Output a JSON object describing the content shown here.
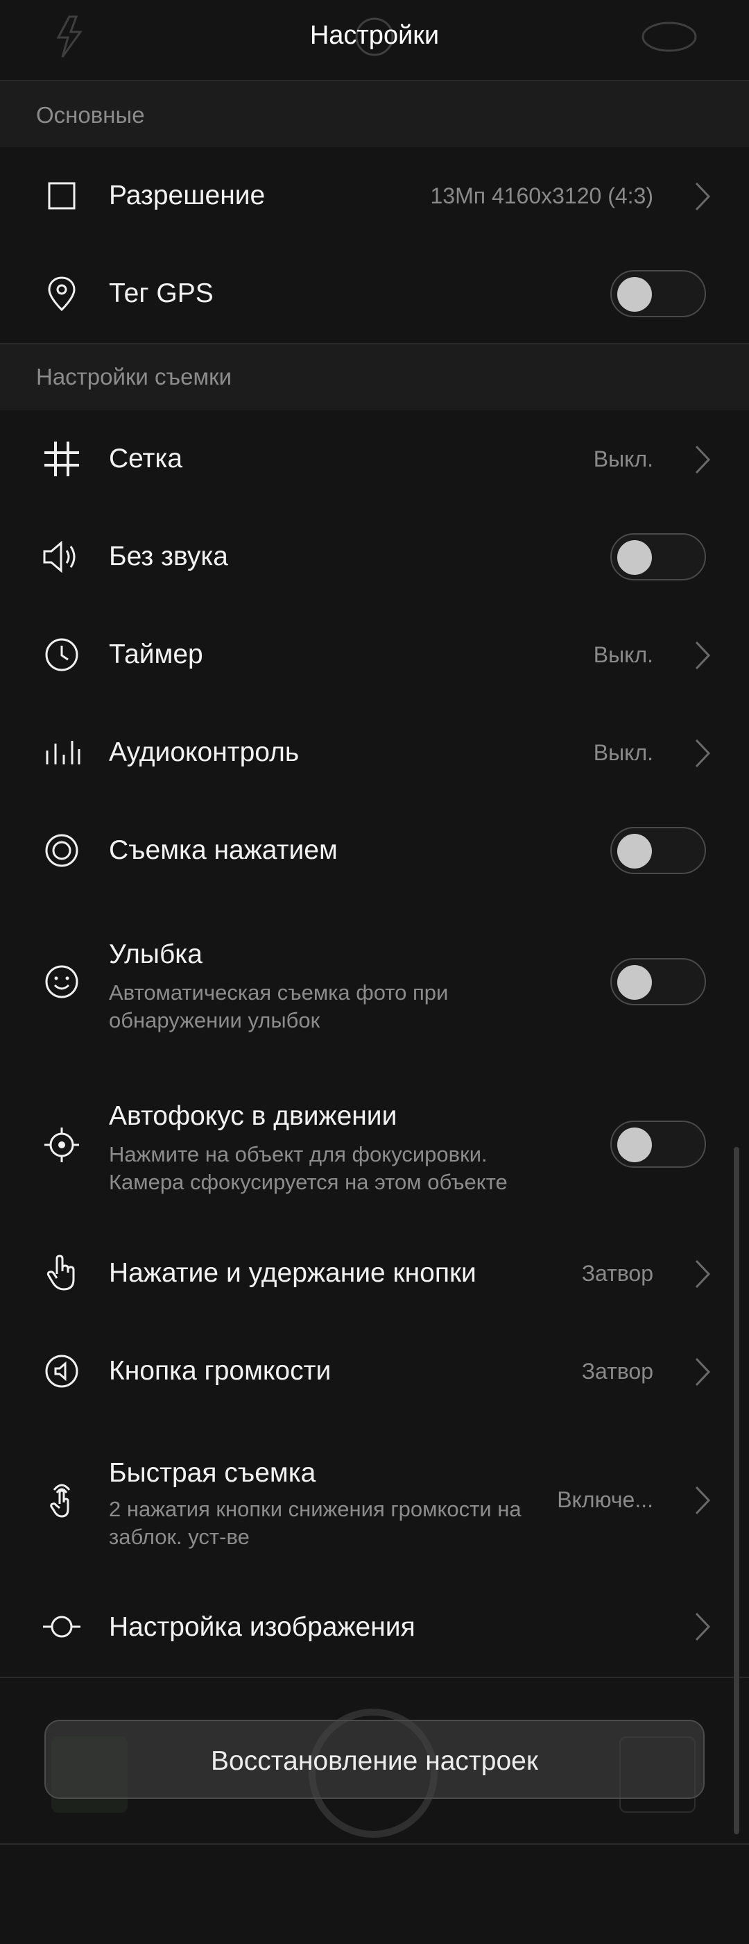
{
  "header": {
    "title": "Настройки"
  },
  "sections": {
    "basic": "Основные",
    "capture": "Настройки съемки"
  },
  "rows": {
    "resolution": {
      "title": "Разрешение",
      "value": "13Мп 4160x3120 (4:3)",
      "icon": "resolution-icon"
    },
    "gps": {
      "title": "Тег GPS",
      "toggle": false,
      "icon": "location-pin-icon"
    },
    "grid": {
      "title": "Сетка",
      "value": "Выкл.",
      "icon": "grid-icon"
    },
    "mute": {
      "title": "Без звука",
      "toggle": false,
      "icon": "speaker-icon"
    },
    "timer": {
      "title": "Таймер",
      "value": "Выкл.",
      "icon": "clock-icon"
    },
    "audio": {
      "title": "Аудиоконтроль",
      "value": "Выкл.",
      "icon": "audio-bars-icon"
    },
    "touch": {
      "title": "Съемка нажатием",
      "toggle": false,
      "icon": "touch-shutter-icon"
    },
    "smile": {
      "title": "Улыбка",
      "sub": "Автоматическая съемка фото при обнаружении улыбок",
      "toggle": false,
      "icon": "smile-icon"
    },
    "autofocus": {
      "title": "Автофокус в движении",
      "sub": "Нажмите на объект для фокусировки. Камера сфокусируется на этом объекте",
      "toggle": false,
      "icon": "focus-target-icon"
    },
    "hold": {
      "title": "Нажатие и удержание кнопки",
      "value": "Затвор",
      "icon": "hand-pointer-icon"
    },
    "volume": {
      "title": "Кнопка громкости",
      "value": "Затвор",
      "icon": "volume-button-icon"
    },
    "quick": {
      "title": "Быстрая съемка",
      "sub": "2 нажатия кнопки снижения громкости на заблок. уст-ве",
      "value": "Включе...",
      "icon": "quick-tap-icon"
    },
    "image": {
      "title": "Настройка изображения",
      "icon": "image-adjust-icon"
    }
  },
  "reset": {
    "label": "Восстановление настроек"
  },
  "colors": {
    "background": "#141414",
    "section_bg": "#1c1c1c",
    "divider": "#2a2a2a",
    "secondary_text": "#8c8c8c"
  }
}
